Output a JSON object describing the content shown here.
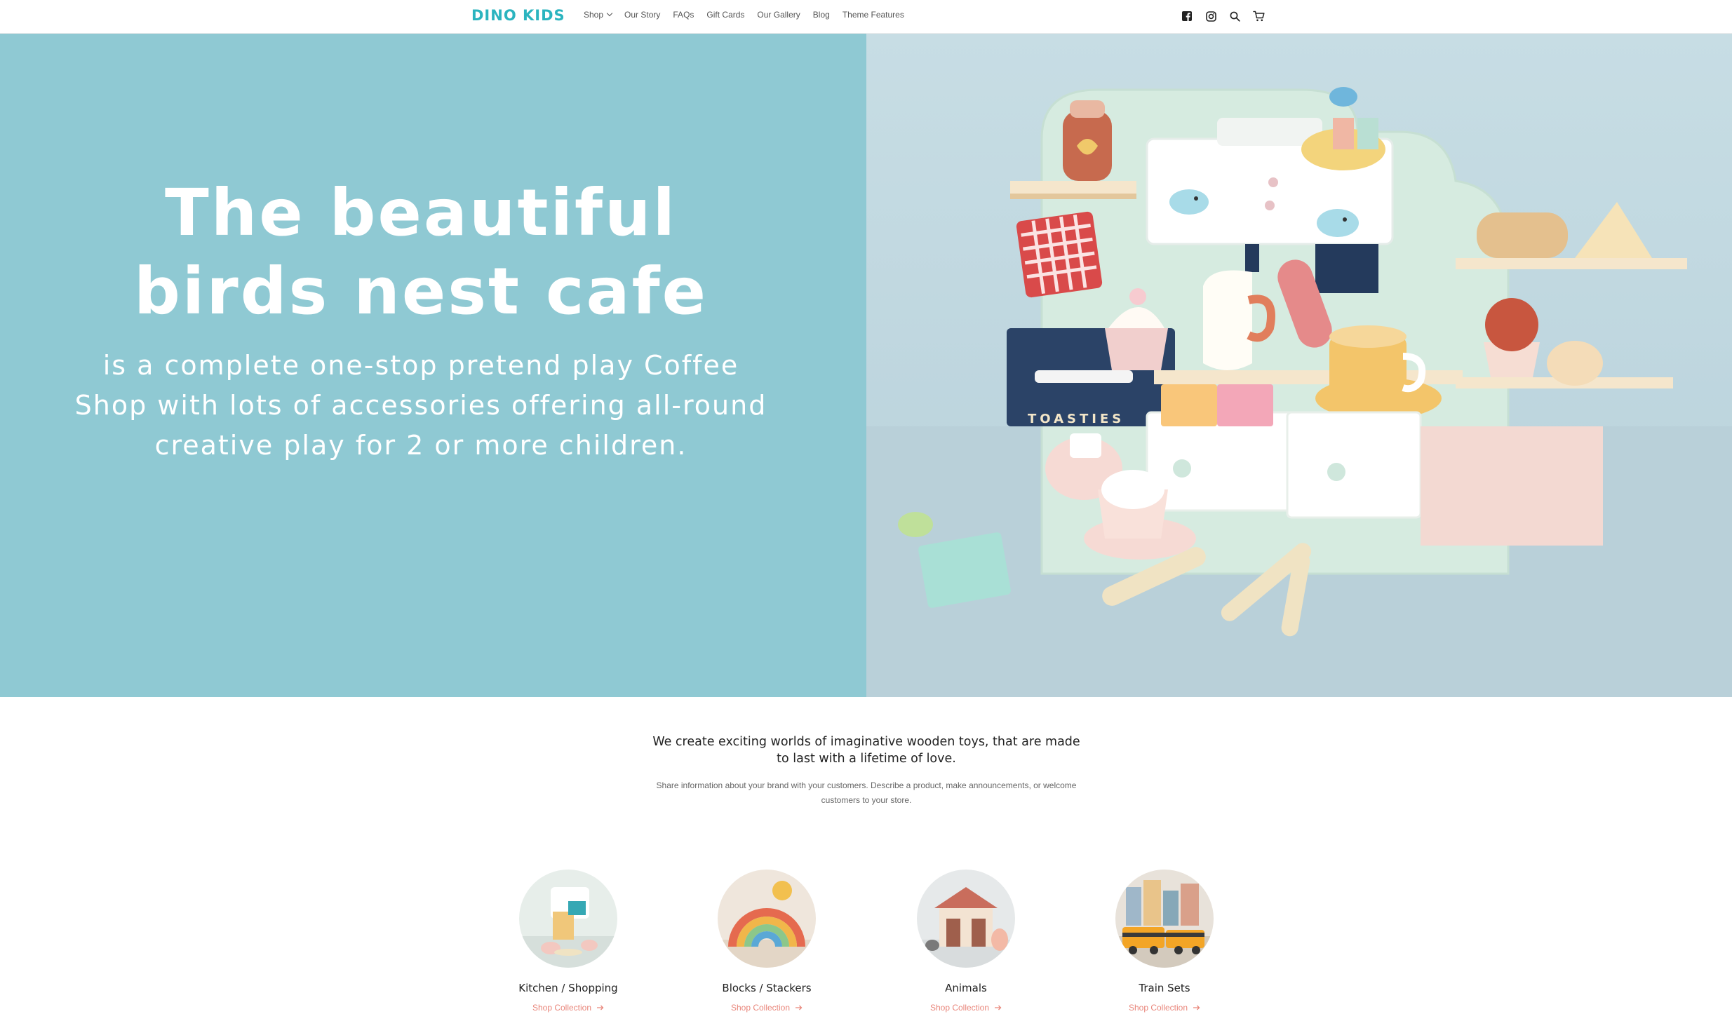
{
  "header": {
    "logo": "DINO KIDS",
    "nav": [
      {
        "label": "Shop",
        "has_dropdown": true
      },
      {
        "label": "Our Story"
      },
      {
        "label": "FAQs"
      },
      {
        "label": "Gift Cards"
      },
      {
        "label": "Our Gallery"
      },
      {
        "label": "Blog"
      },
      {
        "label": "Theme Features"
      }
    ],
    "icons": [
      "facebook-icon",
      "instagram-icon",
      "search-icon",
      "cart-icon"
    ]
  },
  "hero": {
    "title_line1": "The beautiful",
    "title_line2": "birds nest cafe",
    "subtitle": "is a complete one-stop pretend play Coffee Shop with lots of accessories offering all-round creative play for 2 or more children.",
    "left_bg": "#8fc9d3"
  },
  "intro": {
    "heading": "We create exciting worlds of imaginative wooden toys, that are made to last with a lifetime of love.",
    "body": "Share information about your brand with your customers. Describe a product, make announcements, or welcome customers to your store."
  },
  "collections": [
    {
      "name": "Kitchen / Shopping",
      "link": "Shop Collection"
    },
    {
      "name": "Blocks / Stackers",
      "link": "Shop Collection"
    },
    {
      "name": "Animals",
      "link": "Shop Collection"
    },
    {
      "name": "Train Sets",
      "link": "Shop Collection"
    }
  ],
  "colors": {
    "brand": "#2bb4bf",
    "link": "#e9867b",
    "hero_left": "#8fc9d3",
    "hero_right": "#c7dde4"
  }
}
